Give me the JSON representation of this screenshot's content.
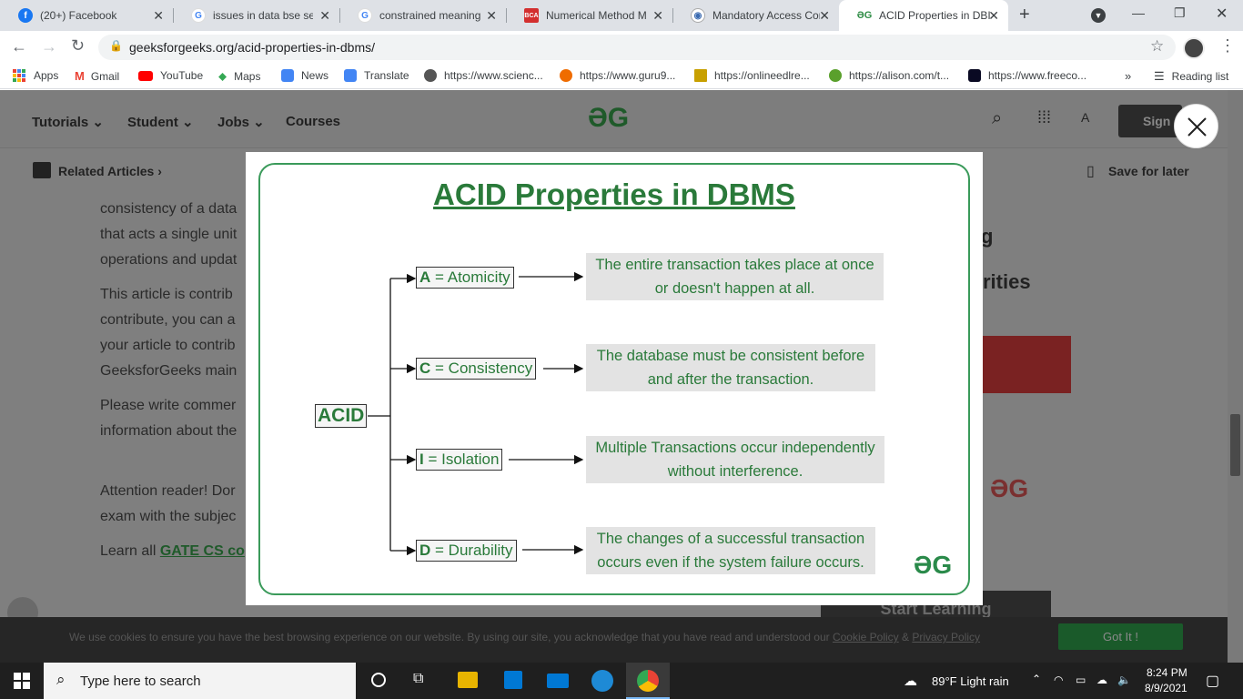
{
  "browser": {
    "tabs": [
      {
        "title": "(20+) Facebook",
        "icon": "facebook-icon",
        "color": "#1877f2",
        "glyph": "f"
      },
      {
        "title": "issues in data bse secu",
        "icon": "google-icon",
        "color": "#4285f4",
        "glyph": "G"
      },
      {
        "title": "constrained meaning",
        "icon": "google-icon",
        "color": "#4285f4",
        "glyph": "G"
      },
      {
        "title": "Numerical Method MC",
        "icon": "bca-icon",
        "color": "#d32f2f",
        "glyph": "B"
      },
      {
        "title": "Mandatory Access Cor",
        "icon": "eye-icon",
        "color": "#3a6ab0",
        "glyph": "◉"
      },
      {
        "title": "ACID Properties in DBI",
        "icon": "gfg-icon",
        "color": "#2f8d46",
        "glyph": "G"
      }
    ],
    "new_tab": "+",
    "url": "geeksforgeeks.org/acid-properties-in-dbms/",
    "bookmarks": [
      {
        "label": "Apps",
        "icon": "apps-grid-icon",
        "color": "#4285f4"
      },
      {
        "label": "Gmail",
        "icon": "gmail-icon",
        "color": "#ea4335"
      },
      {
        "label": "YouTube",
        "icon": "youtube-icon",
        "color": "#ff0000"
      },
      {
        "label": "Maps",
        "icon": "maps-icon",
        "color": "#34a853"
      },
      {
        "label": "News",
        "icon": "news-icon",
        "color": "#4285f4"
      },
      {
        "label": "Translate",
        "icon": "translate-icon",
        "color": "#4285f4"
      },
      {
        "label": "https://www.scienc...",
        "icon": "globe-icon",
        "color": "#555555"
      },
      {
        "label": "https://www.guru9...",
        "icon": "guru99-icon",
        "color": "#ef6c00"
      },
      {
        "label": "https://onlineedlre...",
        "icon": "bookmark-site-icon",
        "color": "#c8a000"
      },
      {
        "label": "https://alison.com/t...",
        "icon": "alison-icon",
        "color": "#5aa02c"
      },
      {
        "label": "https://www.freeco...",
        "icon": "freecodecamp-icon",
        "color": "#0a0a23"
      }
    ],
    "more_bookmarks": "»",
    "reading_list": "Reading list"
  },
  "gfg": {
    "nav": [
      "Tutorials",
      "Student",
      "Jobs",
      "Courses"
    ],
    "sign_in": "Sign",
    "related": "Related Articles",
    "save": "Save for later",
    "article_lines": [
      "consistency of a data",
      "that acts a single unit",
      "operations and updat",
      "This article is contrib",
      "contribute, you can a",
      "your article to contrib",
      "GeeksforGeeks main",
      "Please write commer",
      "information about the",
      "Attention reader! Dor",
      "exam with the subjec"
    ],
    "learn_prefix": "Learn all ",
    "learn_link": "GATE CS co",
    "side_text_1": "g",
    "side_text_2": "rities",
    "start_learning": "Start Learning"
  },
  "cookie": {
    "text": "We use cookies to ensure you have the best browsing experience on our website. By using our site, you acknowledge that you have read and understood our ",
    "policy": "Cookie Policy",
    "amp": " & ",
    "privacy": "Privacy Policy",
    "button": "Got It !"
  },
  "diagram": {
    "title": "ACID Properties in DBMS",
    "root": "ACID",
    "items": [
      {
        "letter": "A",
        "name": "= Atomicity",
        "line1": "The entire transaction takes place at once",
        "line2": "or doesn't happen at all."
      },
      {
        "letter": "C",
        "name": "= Consistency",
        "line1": "The database must be consistent before",
        "line2": "and after the transaction."
      },
      {
        "letter": "I",
        "name": "= Isolation",
        "line1": "Multiple Transactions occur independently",
        "line2": "without interference."
      },
      {
        "letter": "D",
        "name": "= Durability",
        "line1": "The changes of a successful transaction",
        "line2": "occurs even if the system failure occurs."
      }
    ],
    "logo": "ƏG"
  },
  "taskbar": {
    "search_placeholder": "Type here to search",
    "weather": "89°F  Light rain",
    "time": "8:24 PM",
    "date": "8/9/2021"
  }
}
